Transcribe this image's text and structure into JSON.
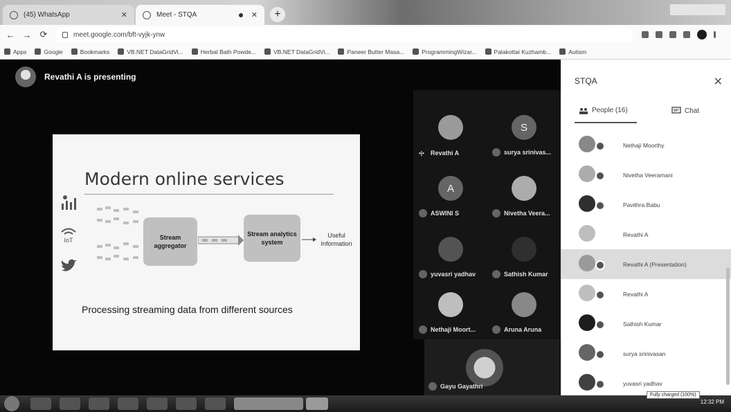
{
  "browser": {
    "tabs": [
      {
        "title": "(45) WhatsApp",
        "active": false
      },
      {
        "title": "Meet - STQA",
        "active": true
      }
    ],
    "url": "meet.google.com/bft-vyjk-ynw",
    "bookmarks": [
      "Apps",
      "Google",
      "Bookmarks",
      "VB.NET DataGridVi...",
      "Herbal Bath Powde...",
      "VB.NET DataGridVi...",
      "Paneer Butter Masa...",
      "ProgrammingWizar...",
      "Palakottai Kuzhamb...",
      "Autism"
    ]
  },
  "meeting": {
    "presenter_text": "Revathi A is presenting",
    "slide": {
      "title": "Modern online services",
      "aggregator": "Stream aggregator",
      "analytics": "Stream analytics system",
      "output": "Useful Information",
      "caption": "Processing streaming data from different sources"
    },
    "tiles": [
      {
        "name": "Revathi A",
        "initial": ""
      },
      {
        "name": "surya srinivas...",
        "initial": "S"
      },
      {
        "name": "ASWINI S",
        "initial": "A"
      },
      {
        "name": "Nivetha Veera...",
        "initial": ""
      },
      {
        "name": "yuvasri yadhav",
        "initial": ""
      },
      {
        "name": "Sathish Kumar",
        "initial": ""
      },
      {
        "name": "Nethaji Moort...",
        "initial": ""
      },
      {
        "name": "Aruna Aruna",
        "initial": ""
      }
    ],
    "self_tile": {
      "name": "Gayu Gayathri"
    }
  },
  "panel": {
    "title": "STQA",
    "people_tab": "People (16)",
    "chat_tab": "Chat",
    "people": [
      "Nethaji Moorthy",
      "Nivetha Veeramani",
      "Pavithra Babu",
      "Revathi A",
      "Revathi A (Presentation)",
      "Revathi A",
      "Sathish Kumar",
      "surya srinivasan",
      "yuvasri yadhav"
    ]
  },
  "taskbar": {
    "clock": "12:32 PM",
    "battery_tooltip": "Fully charged (100%)"
  }
}
